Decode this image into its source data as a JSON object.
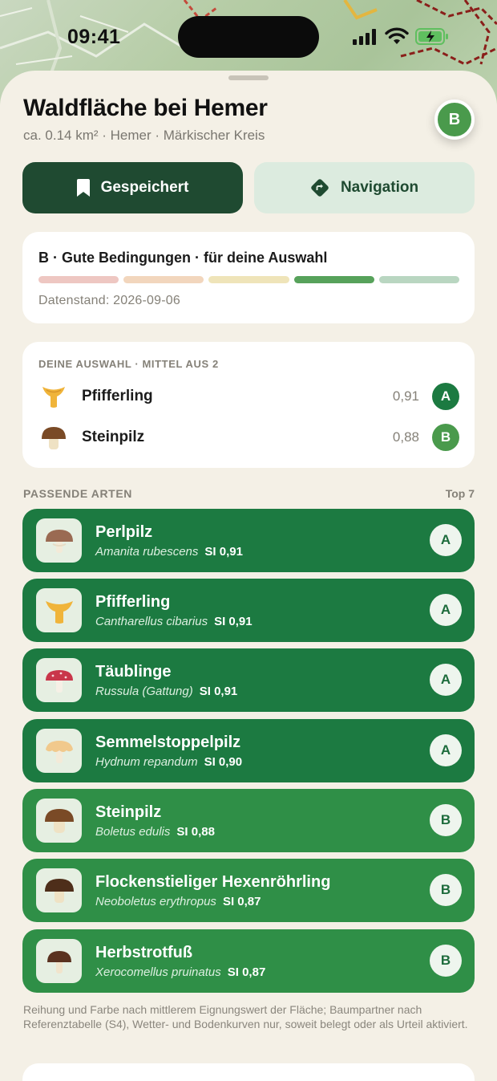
{
  "status": {
    "time": "09:41"
  },
  "header": {
    "title": "Waldfläche bei Hemer",
    "subtitle": "ca. 0.14 km² · Hemer · Märkischer Kreis",
    "grade": "B"
  },
  "actions": {
    "saved_label": "Gespeichert",
    "navigation_label": "Navigation"
  },
  "condition": {
    "title": "B · Gute Bedingungen · für deine Auswahl",
    "scale_colors": [
      "#eec7c2",
      "#f2d6bd",
      "#efe4b9",
      "#57a25b",
      "#b9d6c1"
    ],
    "date": "Datenstand: 2026-09-06"
  },
  "selection": {
    "heading": "DEINE AUSWAHL · MITTEL AUS 2",
    "items": [
      {
        "name": "Pfifferling",
        "value": "0,91",
        "grade": "A",
        "icon": "chanterelle-icon",
        "color": "#1c7a41"
      },
      {
        "name": "Steinpilz",
        "value": "0,88",
        "grade": "B",
        "icon": "porcini-icon",
        "color": "#4a9a4c"
      }
    ]
  },
  "species_section": {
    "label": "PASSENDE ARTEN",
    "top": "Top 7"
  },
  "species": [
    {
      "name": "Perlpilz",
      "latin": "Amanita rubescens",
      "si": "SI 0,91",
      "grade": "A",
      "icon": "blusher-mushroom-icon"
    },
    {
      "name": "Pfifferling",
      "latin": "Cantharellus cibarius",
      "si": "SI 0,91",
      "grade": "A",
      "icon": "chanterelle-icon"
    },
    {
      "name": "Täublinge",
      "latin": "Russula (Gattung)",
      "si": "SI 0,91",
      "grade": "A",
      "icon": "russula-icon"
    },
    {
      "name": "Semmelstoppelpilz",
      "latin": "Hydnum repandum",
      "si": "SI 0,90",
      "grade": "A",
      "icon": "hedgehog-mushroom-icon"
    },
    {
      "name": "Steinpilz",
      "latin": "Boletus edulis",
      "si": "SI 0,88",
      "grade": "B",
      "icon": "porcini-icon"
    },
    {
      "name": "Flockenstieliger Hexenröhrling",
      "latin": "Neoboletus erythropus",
      "si": "SI 0,87",
      "grade": "B",
      "icon": "bolete-icon"
    },
    {
      "name": "Herbstrotfuß",
      "latin": "Xerocomellus pruinatus",
      "si": "SI 0,87",
      "grade": "B",
      "icon": "red-cracking-bolete-icon"
    }
  ],
  "footnote": "Reihung und Farbe nach mittlerem Eignungswert der Fläche; Baumpartner nach Referenztabelle (S4), Wetter- und Bodenkurven nur, soweit belegt oder als Urteil aktiviert."
}
